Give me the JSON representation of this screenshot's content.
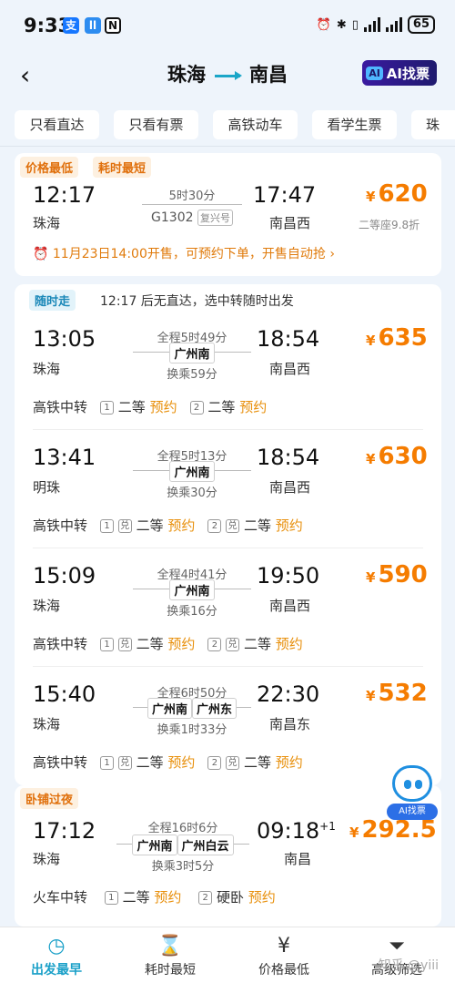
{
  "status_bar": {
    "time": "9:33",
    "battery": "65"
  },
  "header": {
    "from": "珠海",
    "to": "南昌",
    "ai_button": "AI找票",
    "ai_icon": "AI"
  },
  "filters": [
    "只看直达",
    "只看有票",
    "高铁动车",
    "看学生票",
    "珠"
  ],
  "direct": {
    "tags": [
      "价格最低",
      "耗时最短"
    ],
    "dep_time": "12:17",
    "dep_station": "珠海",
    "duration": "5时30分",
    "train_no": "G1302",
    "train_badge": "复兴号",
    "arr_time": "17:47",
    "arr_station": "南昌西",
    "price": "620",
    "yen": "¥",
    "discount": "二等座9.8折",
    "notice": "11月23日14:00开售，可预约下单，开售自动抢 ›"
  },
  "transfer_header": {
    "tag": "随时走",
    "text": "12:17 后无直达，选中转随时出发"
  },
  "transfers": [
    {
      "dep_time": "13:05",
      "dep_station": "珠海",
      "total": "全程5时49分",
      "via": [
        "广州南"
      ],
      "wait": "换乘59分",
      "arr_time": "18:54",
      "arr_station": "南昌西",
      "price": "635",
      "type": "高铁中转",
      "seg1": "二等",
      "seg2": "二等",
      "book": "预约",
      "dui": false
    },
    {
      "dep_time": "13:41",
      "dep_station": "明珠",
      "total": "全程5时13分",
      "via": [
        "广州南"
      ],
      "wait": "换乘30分",
      "arr_time": "18:54",
      "arr_station": "南昌西",
      "price": "630",
      "type": "高铁中转",
      "seg1": "二等",
      "seg2": "二等",
      "book": "预约",
      "dui": true
    },
    {
      "dep_time": "15:09",
      "dep_station": "珠海",
      "total": "全程4时41分",
      "via": [
        "广州南"
      ],
      "wait": "换乘16分",
      "arr_time": "19:50",
      "arr_station": "南昌西",
      "price": "590",
      "type": "高铁中转",
      "seg1": "二等",
      "seg2": "二等",
      "book": "预约",
      "dui": true
    },
    {
      "dep_time": "15:40",
      "dep_station": "珠海",
      "total": "全程6时50分",
      "via": [
        "广州南",
        "广州东"
      ],
      "wait": "换乘1时33分",
      "arr_time": "22:30",
      "arr_station": "南昌东",
      "price": "532",
      "type": "高铁中转",
      "seg1": "二等",
      "seg2": "二等",
      "book": "预约",
      "dui": true
    }
  ],
  "sleeper": {
    "tag": "卧铺过夜",
    "dep_time": "17:12",
    "dep_station": "珠海",
    "total": "全程16时6分",
    "via": [
      "广州南",
      "广州白云"
    ],
    "wait": "换乘3时5分",
    "arr_time": "09:18",
    "plus": "+1",
    "arr_station": "南昌",
    "price": "292.5",
    "type": "火车中转",
    "seg1": "二等",
    "seg2": "硬卧",
    "book": "预约"
  },
  "float_ai": "AI找票",
  "bottom_nav": [
    "出发最早",
    "耗时最短",
    "价格最低",
    "高级筛选"
  ],
  "watermark": "知乎 @yiii",
  "colors": {
    "accent": "#1aa0c8",
    "price": "#f57c00",
    "tag": "#e0700c"
  }
}
